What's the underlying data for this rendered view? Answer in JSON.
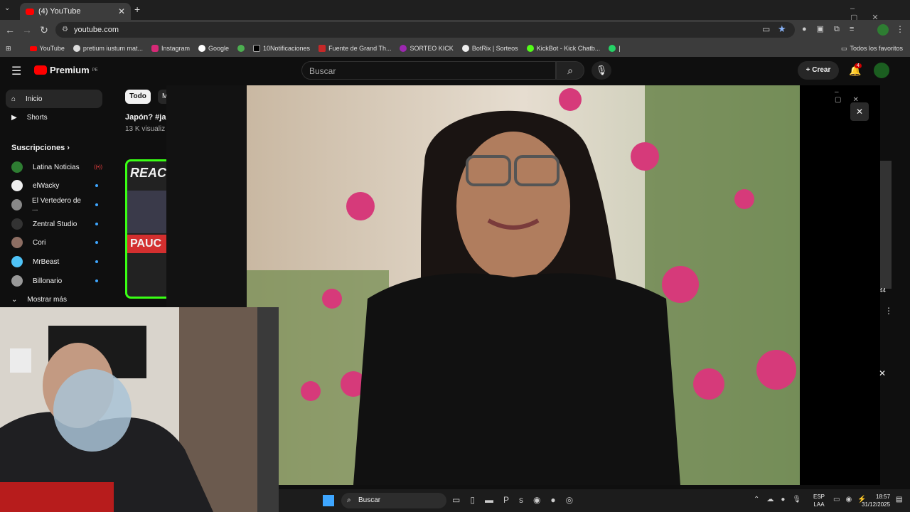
{
  "browser": {
    "tab_title": "(4) YouTube",
    "new_tab": "+",
    "url": "youtube.com",
    "bookmarks": [
      "YouTube",
      "pretium iustum mat...",
      "Instagram",
      "Google",
      "10Notificaciones",
      "Fuente de Grand Th...",
      "SORTEO KICK",
      "BotRix | Sorteos",
      "KickBot - Kick Chatb...",
      "|"
    ],
    "all_bookmarks": "Todos los favoritos"
  },
  "youtube": {
    "logo": "Premium",
    "region": "PE",
    "search_placeholder": "Buscar",
    "create": "Crear",
    "notifications": "4",
    "chip_all": "Todo",
    "chip_m": "M",
    "video_title": "Japón?  #jap",
    "video_views": "13 K visualiz",
    "thumb_title": "REAC",
    "thumb_sub": "PAUC",
    "right_count": "44"
  },
  "sidebar": {
    "home": "Inicio",
    "shorts": "Shorts",
    "subs_title": "Suscripciones",
    "subs": [
      {
        "name": "Latina Noticias",
        "badge": "((•))"
      },
      {
        "name": "elWacky"
      },
      {
        "name": "El Vertedero de ..."
      },
      {
        "name": "Zentral Studio"
      },
      {
        "name": "Cori"
      },
      {
        "name": "MrBeast"
      },
      {
        "name": "Billonario"
      }
    ],
    "more": "Mostrar más"
  },
  "taskbar": {
    "search": "Buscar",
    "lang1": "ESP",
    "lang2": "LAA",
    "time": "18:57",
    "date": "31/12/2025"
  },
  "colors": {
    "yt_red": "#ff0000",
    "accent_blue": "#3ea6ff"
  }
}
